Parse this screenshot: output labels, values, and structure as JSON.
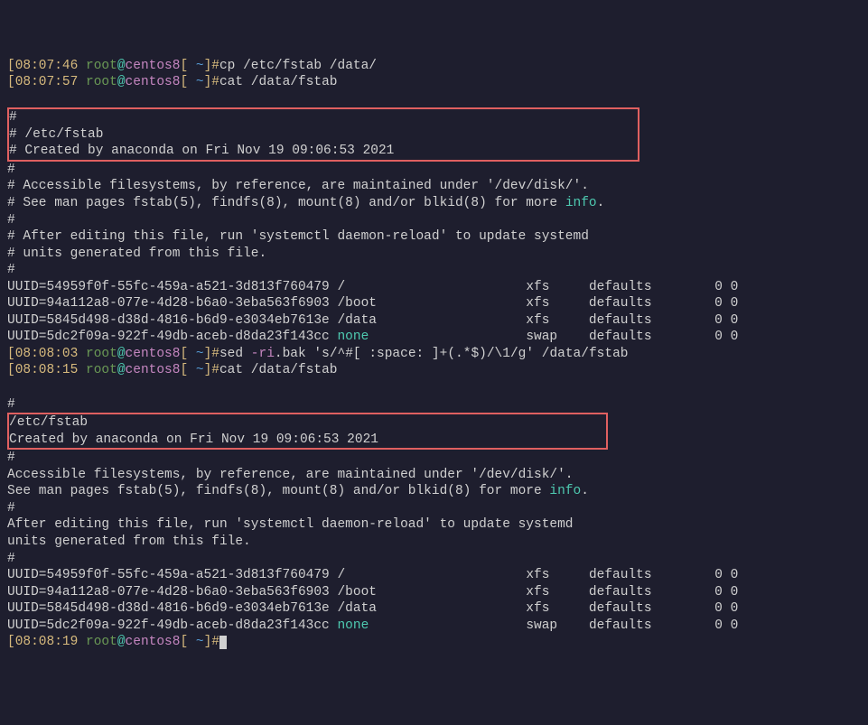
{
  "prompts": [
    {
      "time": "08:07:46",
      "user": "root",
      "host": "centos8",
      "dir": "~",
      "cmd": "cp /etc/fstab /data/"
    },
    {
      "time": "08:07:57",
      "user": "root",
      "host": "centos8",
      "dir": "~",
      "cmd": "cat /data/fstab"
    },
    {
      "time": "08:08:03",
      "user": "root",
      "host": "centos8",
      "dir": "~",
      "cmd_pre": "sed ",
      "cmd_opt": "-ri",
      "cmd_post": ".bak 's/^#[ :space: ]+(.*$)/\\1/g' /data/fstab"
    },
    {
      "time": "08:08:15",
      "user": "root",
      "host": "centos8",
      "dir": "~",
      "cmd": "cat /data/fstab"
    },
    {
      "time": "08:08:19",
      "user": "root",
      "host": "centos8",
      "dir": "~",
      "cmd": ""
    }
  ],
  "fstab1": {
    "hdr_lines": {
      "l1": "# /etc/fstab",
      "l2": "# Created by anaconda on Fri Nov 19 09:06:53 2021"
    },
    "body": {
      "l1": "# Accessible filesystems, by reference, are maintained under '/dev/disk/'.",
      "l2a": "# See man pages fstab(5), findfs(8), mount(8) and/or blkid(8) for more ",
      "l2b": "info",
      "l2c": ".",
      "l3": "# After editing this file, run 'systemctl daemon-reload' to update systemd",
      "l4": "# units generated from this file."
    },
    "rows": [
      {
        "dev": "UUID=54959f0f-55fc-459a-a521-3d813f760479 /",
        "fs": "xfs",
        "opts": "defaults",
        "d1": "0",
        "d2": "0"
      },
      {
        "dev": "UUID=94a112a8-077e-4d28-b6a0-3eba563f6903 /boot",
        "fs": "xfs",
        "opts": "defaults",
        "d1": "0",
        "d2": "0"
      },
      {
        "dev": "UUID=5845d498-d38d-4816-b6d9-e3034eb7613e /data",
        "fs": "xfs",
        "opts": "defaults",
        "d1": "0",
        "d2": "0"
      },
      {
        "dev": "UUID=5dc2f09a-922f-49db-aceb-d8da23f143cc ",
        "fs_pre": "none",
        "fs": "swap",
        "opts": "defaults",
        "d1": "0",
        "d2": "0"
      }
    ]
  },
  "fstab2": {
    "hdr_lines": {
      "l1": "/etc/fstab",
      "l2": "Created by anaconda on Fri Nov 19 09:06:53 2021"
    },
    "body": {
      "l1": "Accessible filesystems, by reference, are maintained under '/dev/disk/'.",
      "l2a": "See man pages fstab(5), findfs(8), mount(8) and/or blkid(8) for more ",
      "l2b": "info",
      "l2c": ".",
      "l3": "After editing this file, run 'systemctl daemon-reload' to update systemd",
      "l4": "units generated from this file."
    },
    "rows": [
      {
        "dev": "UUID=54959f0f-55fc-459a-a521-3d813f760479 /",
        "fs": "xfs",
        "opts": "defaults",
        "d1": "0",
        "d2": "0"
      },
      {
        "dev": "UUID=94a112a8-077e-4d28-b6a0-3eba563f6903 /boot",
        "fs": "xfs",
        "opts": "defaults",
        "d1": "0",
        "d2": "0"
      },
      {
        "dev": "UUID=5845d498-d38d-4816-b6d9-e3034eb7613e /data",
        "fs": "xfs",
        "opts": "defaults",
        "d1": "0",
        "d2": "0"
      },
      {
        "dev": "UUID=5dc2f09a-922f-49db-aceb-d8da23f143cc ",
        "fs_pre": "none",
        "fs": "swap",
        "opts": "defaults",
        "d1": "0",
        "d2": "0"
      }
    ]
  },
  "hash": "#"
}
